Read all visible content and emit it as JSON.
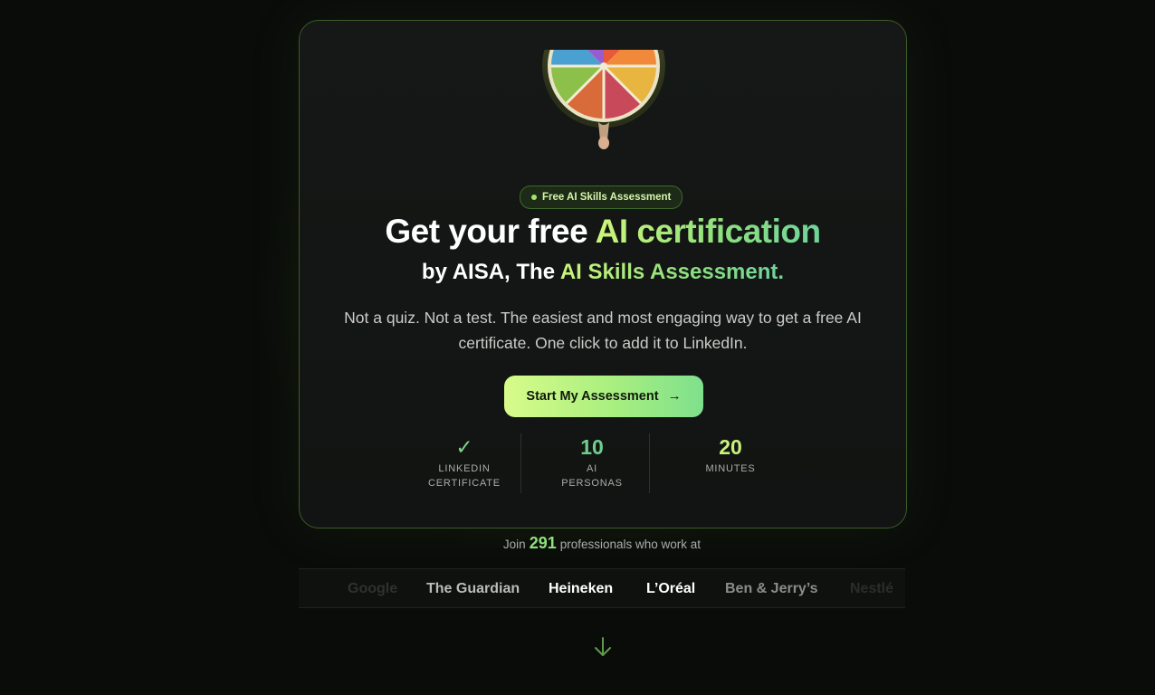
{
  "badge": {
    "label": "Free AI Skills Assessment"
  },
  "hero": {
    "title_prefix": "Get your free ",
    "title_highlight": "AI certification",
    "subtitle_prefix": "by AISA, The ",
    "subtitle_highlight": "AI Skills Assessment.",
    "description": "Not a quiz. Not a test. The easiest and most engaging way to get a free AI certificate. One click to add it to LinkedIn."
  },
  "cta": {
    "label": "Start My Assessment",
    "icon": "arrow-right-icon"
  },
  "stats": [
    {
      "value": "✓",
      "label": "LINKEDIN\nCERTIFICATE",
      "color": "#7fd68a"
    },
    {
      "value": "10",
      "label": "AI\nPERSONAS",
      "color": "#6fcf8f"
    },
    {
      "value": "20",
      "label": "MINUTES",
      "color": "#c9f27d"
    }
  ],
  "join": {
    "prefix": "Join",
    "count": "291",
    "suffix": "professionals who work at"
  },
  "companies": [
    "Google",
    "The Guardian",
    "Heineken",
    "L’Oréal",
    "Ben & Jerry’s",
    "Nestlé"
  ],
  "colors": {
    "accent_light": "#cdf67a",
    "accent_green": "#6fd39a",
    "border": "#3d5a2a",
    "background": "#0a0c0a"
  }
}
